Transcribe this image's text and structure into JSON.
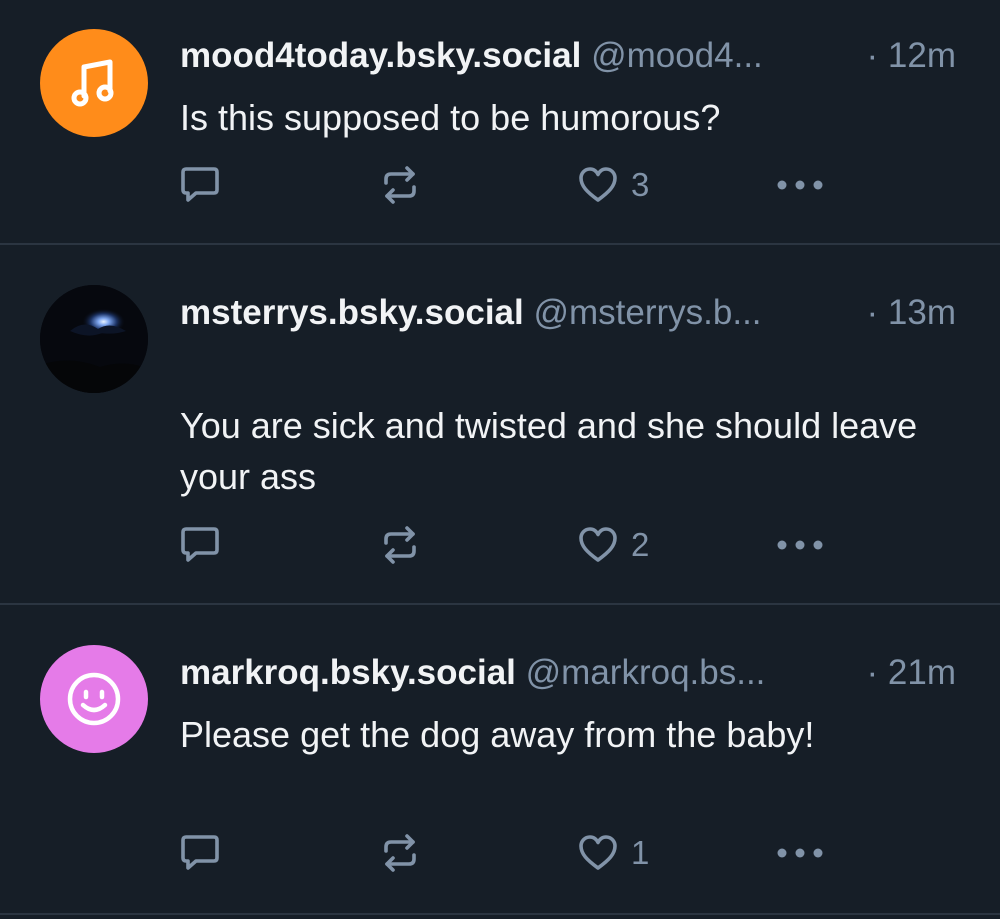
{
  "colors": {
    "background": "#161e27",
    "divider": "#2b3541",
    "text": "#f1f3f5",
    "muted": "#8193a8",
    "avatar_orange": "#ff8c1a",
    "avatar_pink": "#e57be8"
  },
  "posts": [
    {
      "avatar_icon": "music-note-icon",
      "display_name": "mood4today.bsky.social",
      "handle": "@mood4...",
      "time": "· 12m",
      "text": "Is this supposed to be humorous?",
      "likes": "3"
    },
    {
      "avatar_icon": "night-sky-photo",
      "display_name": "msterrys.bsky.social",
      "handle": "@msterrys.b...",
      "time": "· 13m",
      "text": "You are sick and twisted and she should leave your ass",
      "likes": "2"
    },
    {
      "avatar_icon": "smiley-face-icon",
      "display_name": "markroq.bsky.social",
      "handle": "@markroq.bs...",
      "time": "· 21m",
      "text": "Please get the dog away from the baby!",
      "likes": "1"
    }
  ]
}
